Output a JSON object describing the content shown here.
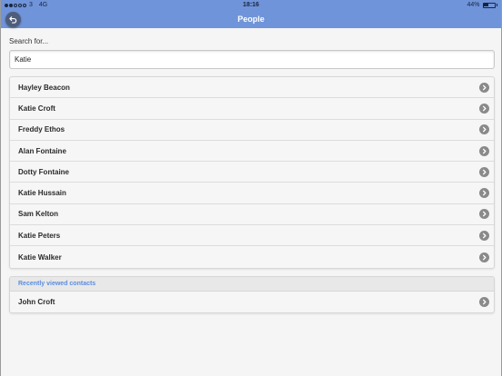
{
  "status": {
    "carrier": "3",
    "network": "4G",
    "time": "18:16",
    "battery_text": "44%",
    "battery_level": 0.44
  },
  "nav": {
    "title": "People",
    "back_icon": "undo-arrow-icon"
  },
  "search": {
    "label": "Search for...",
    "value": "Katie"
  },
  "results": [
    {
      "name": "Hayley Beacon"
    },
    {
      "name": "Katie Croft"
    },
    {
      "name": "Freddy Ethos"
    },
    {
      "name": "Alan Fontaine"
    },
    {
      "name": "Dotty Fontaine"
    },
    {
      "name": "Katie Hussain"
    },
    {
      "name": "Sam Kelton"
    },
    {
      "name": "Katie Peters"
    },
    {
      "name": "Katie Walker"
    }
  ],
  "recent": {
    "header": "Recently viewed contacts",
    "items": [
      {
        "name": "John Croft"
      }
    ]
  },
  "colors": {
    "accent": "#6f94d9",
    "section_header": "#5b8de0",
    "chevron": "#8a8a8a"
  }
}
